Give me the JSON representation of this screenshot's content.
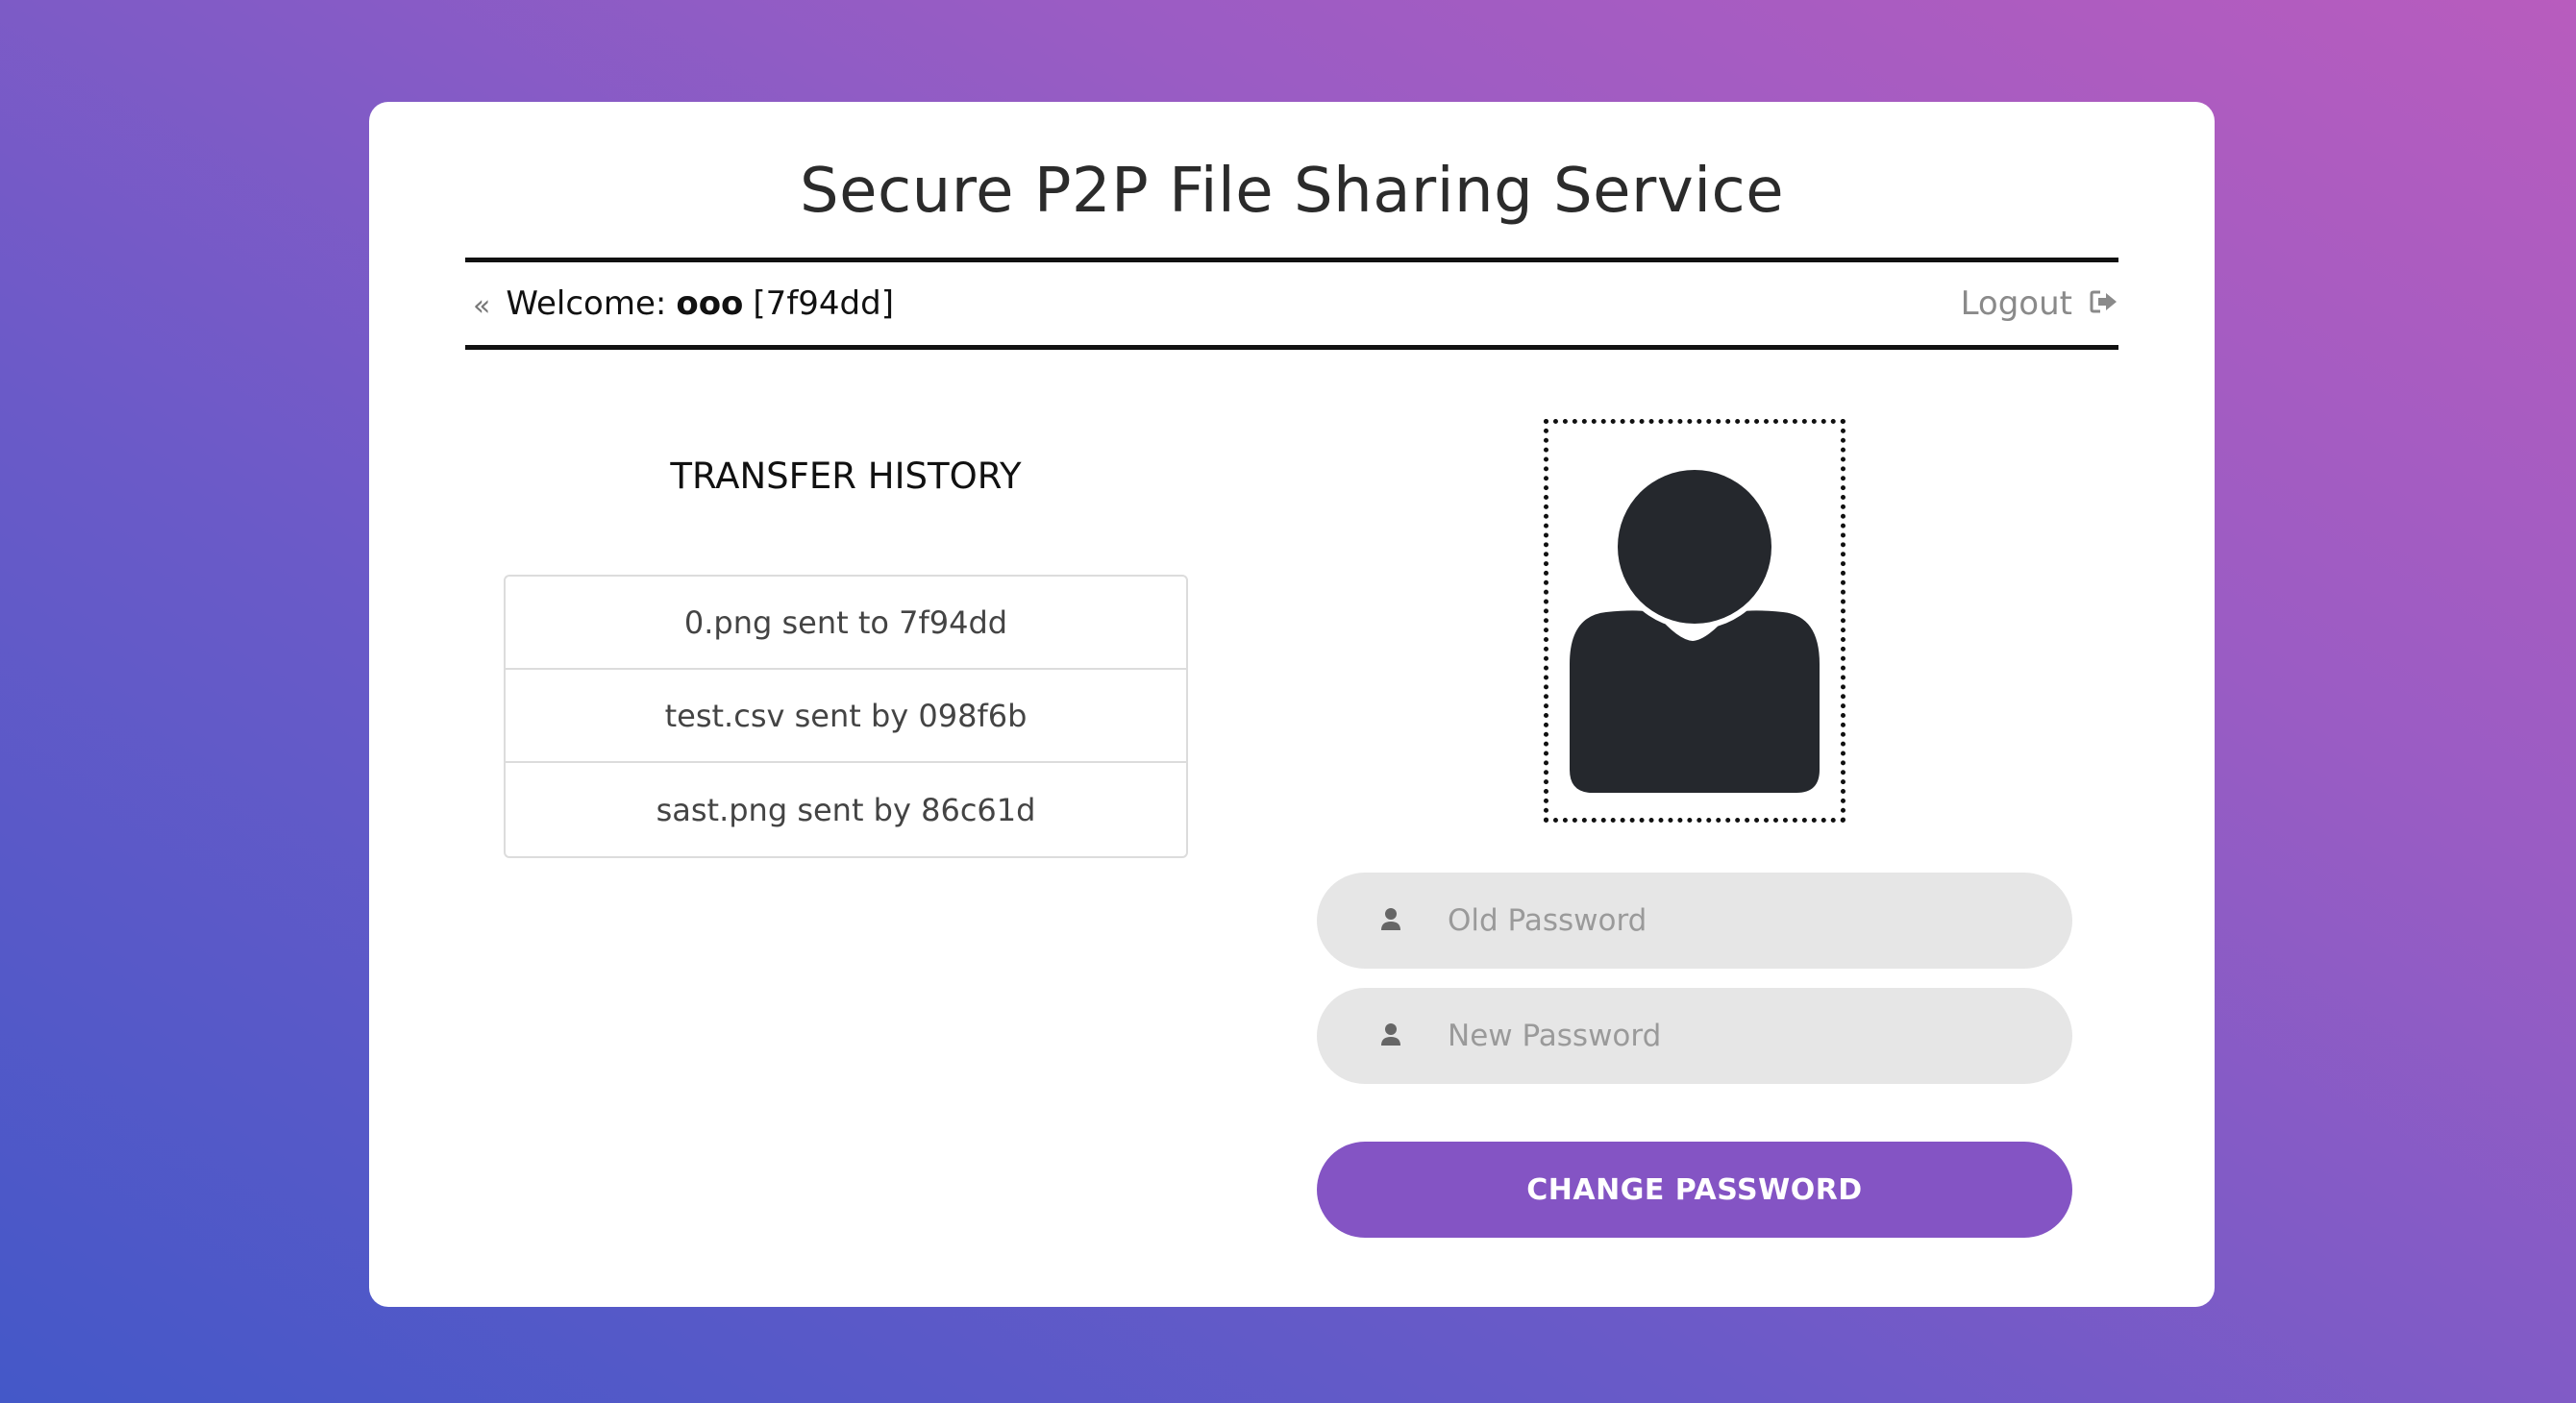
{
  "app": {
    "title": "Secure P2P File Sharing Service"
  },
  "userbar": {
    "welcome_label": "Welcome:",
    "username": "ooo",
    "user_id": "[7f94dd]",
    "logout_label": "Logout"
  },
  "history": {
    "title": "TRANSFER HISTORY",
    "items": [
      "0.png sent to 7f94dd",
      "test.csv sent by 098f6b",
      "sast.png sent by 86c61d"
    ]
  },
  "profile": {
    "avatar_icon": "user-silhouette-icon",
    "old_password": {
      "placeholder": "Old Password",
      "value": "",
      "icon": "user-icon"
    },
    "new_password": {
      "placeholder": "New Password",
      "value": "",
      "icon": "user-icon"
    },
    "change_button_label": "CHANGE PASSWORD"
  },
  "colors": {
    "accent": "#8454c4",
    "field_bg": "#e6e6e6",
    "icon_dark": "#25282d"
  }
}
